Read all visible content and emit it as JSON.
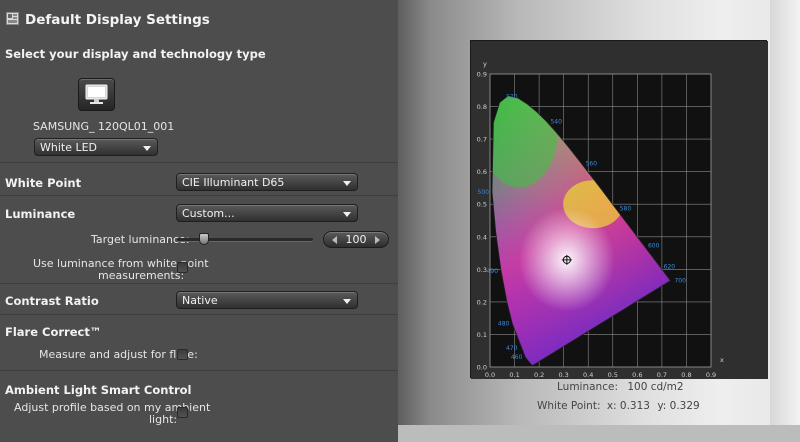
{
  "header": {
    "title": "Default Display Settings",
    "icon": "display-settings-icon"
  },
  "display": {
    "section_title": "Select your display and technology type",
    "monitor_icon": "monitor-icon",
    "display_name": "SAMSUNG_",
    "display_model": "120QL01_001",
    "technology": "White LED"
  },
  "white_point": {
    "label": "White Point",
    "value": "CIE Illuminant D65"
  },
  "luminance": {
    "label": "Luminance",
    "value": "Custom...",
    "target_label": "Target luminance:",
    "target_value": "100",
    "slider_fraction": 0.2,
    "use_measurements_label_1": "Use luminance from white point",
    "use_measurements_label_2": "measurements:",
    "use_measurements_checked": false
  },
  "contrast": {
    "label": "Contrast Ratio",
    "value": "Native"
  },
  "flare": {
    "label": "Flare Correct™",
    "measure_label": "Measure and adjust for flare:",
    "measure_checked": false
  },
  "ambient": {
    "label": "Ambient Light Smart Control",
    "adjust_label_1": "Adjust profile based on my ambient",
    "adjust_label_2": "light:",
    "adjust_checked": false
  },
  "chart_info": {
    "luminance_label": "Luminance:",
    "luminance_value": "100 cd/m2",
    "white_point_label": "White Point:",
    "white_point_x": "x: 0.313",
    "white_point_y": "y: 0.329"
  },
  "chart_data": {
    "type": "scatter",
    "title": "",
    "xlabel": "x",
    "ylabel": "y",
    "xlim": [
      0.0,
      0.9
    ],
    "ylim": [
      0.0,
      0.9
    ],
    "grid": true,
    "x_ticks": [
      "0.0",
      "0.1",
      "0.2",
      "0.3",
      "0.4",
      "0.5",
      "0.6",
      "0.7",
      "0.8",
      "0.9"
    ],
    "y_ticks": [
      "0.0",
      "0.1",
      "0.2",
      "0.3",
      "0.4",
      "0.5",
      "0.6",
      "0.7",
      "0.8",
      "0.9"
    ],
    "locus": [
      [
        0.1741,
        0.005
      ],
      [
        0.1666,
        0.0089
      ],
      [
        0.144,
        0.0297
      ],
      [
        0.0913,
        0.1327
      ],
      [
        0.0687,
        0.2007
      ],
      [
        0.0454,
        0.295
      ],
      [
        0.0235,
        0.4127
      ],
      [
        0.0082,
        0.5384
      ],
      [
        0.0139,
        0.7502
      ],
      [
        0.0389,
        0.812
      ],
      [
        0.0743,
        0.8338
      ],
      [
        0.1142,
        0.8262
      ],
      [
        0.1547,
        0.8059
      ],
      [
        0.1929,
        0.7816
      ],
      [
        0.2296,
        0.7543
      ],
      [
        0.2658,
        0.7243
      ],
      [
        0.3016,
        0.6923
      ],
      [
        0.3373,
        0.6589
      ],
      [
        0.3731,
        0.6245
      ],
      [
        0.4087,
        0.5896
      ],
      [
        0.4441,
        0.5547
      ],
      [
        0.4788,
        0.5202
      ],
      [
        0.5125,
        0.4866
      ],
      [
        0.5448,
        0.4544
      ],
      [
        0.5752,
        0.4242
      ],
      [
        0.6029,
        0.3965
      ],
      [
        0.627,
        0.3725
      ],
      [
        0.6482,
        0.3514
      ],
      [
        0.6658,
        0.334
      ],
      [
        0.6915,
        0.3083
      ],
      [
        0.7347,
        0.2653
      ]
    ],
    "wavelength_labels": [
      {
        "text": "520",
        "x": 0.074,
        "y": 0.834
      },
      {
        "text": "540",
        "x": 0.23,
        "y": 0.754
      },
      {
        "text": "560",
        "x": 0.373,
        "y": 0.625
      },
      {
        "text": "580",
        "x": 0.512,
        "y": 0.487
      },
      {
        "text": "600",
        "x": 0.627,
        "y": 0.373
      },
      {
        "text": "620",
        "x": 0.691,
        "y": 0.308
      },
      {
        "text": "700",
        "x": 0.735,
        "y": 0.265
      },
      {
        "text": "500",
        "x": 0.008,
        "y": 0.538
      },
      {
        "text": "490",
        "x": 0.045,
        "y": 0.295
      },
      {
        "text": "480",
        "x": 0.091,
        "y": 0.133
      },
      {
        "text": "470",
        "x": 0.124,
        "y": 0.058
      },
      {
        "text": "460",
        "x": 0.144,
        "y": 0.03
      }
    ],
    "white_point": {
      "x": 0.313,
      "y": 0.329
    }
  }
}
